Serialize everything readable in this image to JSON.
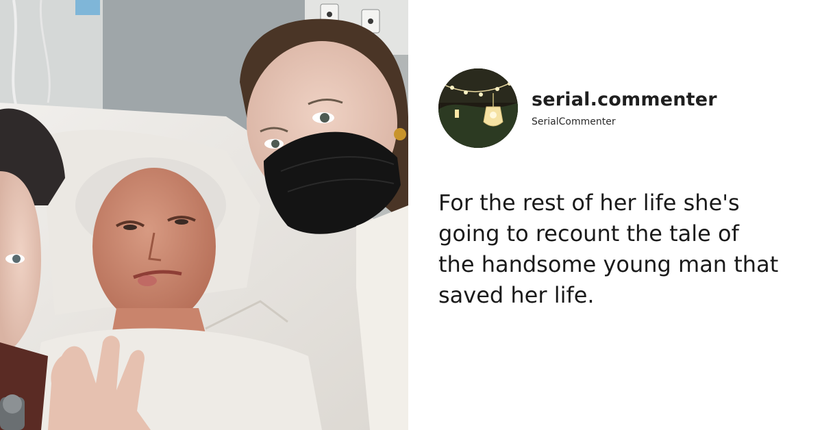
{
  "photo": {
    "description_icon": "hospital-selfie-photo"
  },
  "comment": {
    "username": "serial.commenter",
    "handle": "SerialCommenter",
    "text": "For the rest of her life she's going to recount the tale of the handsome young man that saved her life."
  },
  "colors": {
    "text": "#1a1a1a",
    "background": "#ffffff"
  }
}
